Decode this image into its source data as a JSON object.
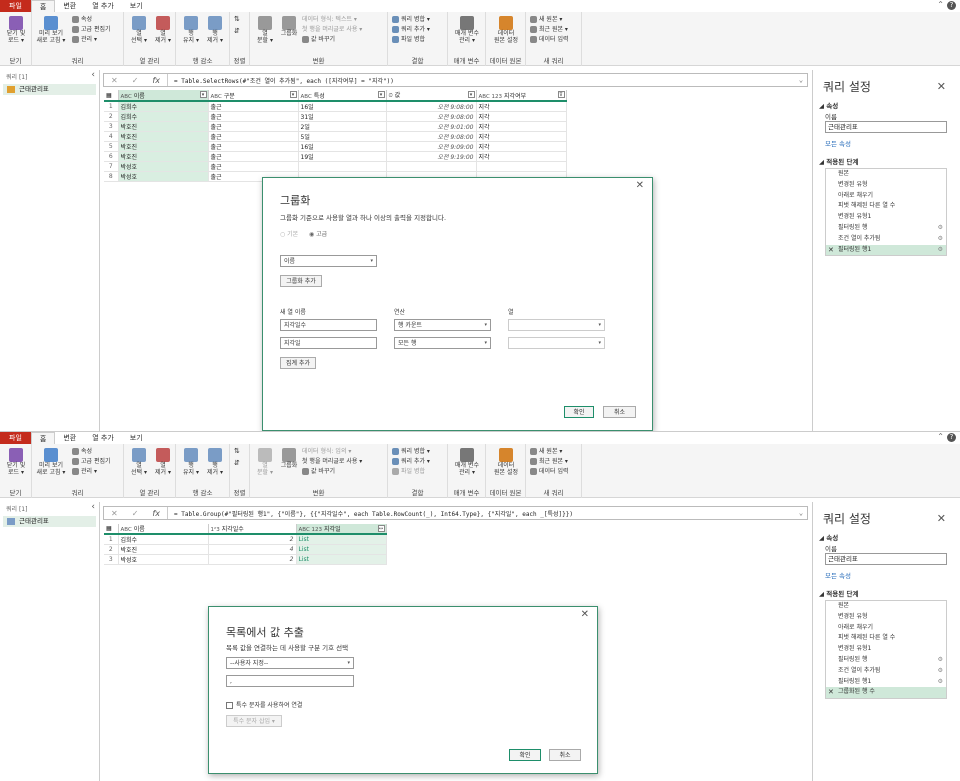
{
  "ribbon": {
    "tabs": [
      "파일",
      "홈",
      "변환",
      "열 추가",
      "보기"
    ],
    "groups": [
      {
        "name": "닫기",
        "buttons": [
          "닫기 및\n로드 ▾"
        ]
      },
      {
        "name": "쿼리",
        "buttons": [
          "미리 보기\n새로 고침 ▾",
          "속성",
          "고급 편집기",
          "관리 ▾"
        ]
      },
      {
        "name": "열 관리",
        "buttons": [
          "열\n선택 ▾",
          "열\n제거 ▾"
        ]
      },
      {
        "name": "행 감소",
        "buttons": [
          "행\n유지 ▾",
          "행\n제거 ▾"
        ]
      },
      {
        "name": "정렬",
        "buttons": []
      },
      {
        "name": "변환",
        "buttons": [
          "열\n분할 ▾",
          "그룹화",
          "첫 행을 머리글로 사용 ▾",
          "값 바꾸기"
        ]
      },
      {
        "name": "결합",
        "buttons": [
          "쿼리 병합 ▾",
          "쿼리 추가 ▾",
          "파일 병합"
        ]
      },
      {
        "name": "매개 변수",
        "buttons": [
          "매개 변수\n관리 ▾"
        ]
      },
      {
        "name": "데이터 원본",
        "buttons": [
          "데이터\n원본 설정"
        ]
      },
      {
        "name": "새 쿼리",
        "buttons": [
          "새 원본 ▾",
          "최근 원본 ▾",
          "데이터 입력"
        ]
      }
    ],
    "datatype_1": "데이터 형식: 텍스트 ▾",
    "datatype_2": "데이터 형식: 임의 ▾"
  },
  "left_panel": {
    "header": "쿼리 [1]",
    "query_name": "근태관리표"
  },
  "screen1": {
    "formula": "= Table.SelectRows(#\"조건 열이 추가됨\", each ([지각여부] = \"지각\"))",
    "columns": [
      {
        "type": "ABC",
        "name": "이름"
      },
      {
        "type": "ABC",
        "name": "구분"
      },
      {
        "type": "ABC",
        "name": "특성"
      },
      {
        "type": "⏲",
        "name": "값"
      },
      {
        "type": "ABC 123",
        "name": "지각여부"
      }
    ],
    "rows": [
      [
        "1",
        "김희수",
        "출근",
        "16일",
        "오전 9:08:00",
        "지각"
      ],
      [
        "2",
        "김희수",
        "출근",
        "31일",
        "오전 9:08:00",
        "지각"
      ],
      [
        "3",
        "박호진",
        "출근",
        "2일",
        "오전 9:01:00",
        "지각"
      ],
      [
        "4",
        "박호진",
        "출근",
        "5일",
        "오전 9:08:00",
        "지각"
      ],
      [
        "5",
        "박호진",
        "출근",
        "16일",
        "오전 9:09:00",
        "지각"
      ],
      [
        "6",
        "박호진",
        "출근",
        "19일",
        "오전 9:19:00",
        "지각"
      ],
      [
        "7",
        "박성호",
        "출근",
        "",
        "",
        ""
      ],
      [
        "8",
        "박성호",
        "출근",
        "",
        "",
        ""
      ]
    ],
    "dialog": {
      "title": "그룹화",
      "subtitle": "그룹화 기준으로 사용할 열과 하나 이상의 출력을 지정합니다.",
      "radio_basic": "○ 기본",
      "radio_advanced": "◉ 고급",
      "group_by_value": "이름",
      "add_group_button": "그룹화 추가",
      "col_new_name": "새 열 이름",
      "col_operation": "연산",
      "col_column": "열",
      "agg1_name": "지각일수",
      "agg1_op": "행 카운트",
      "agg2_name": "지각일",
      "agg2_op": "모든 행",
      "add_agg_button": "집계 추가",
      "ok": "확인",
      "cancel": "취소"
    }
  },
  "screen2": {
    "formula": "= Table.Group(#\"필터링된 행1\", {\"이름\"}, {{\"지각일수\", each Table.RowCount(_), Int64.Type}, {\"지각일\", each _[특성]}})",
    "columns": [
      {
        "type": "ABC",
        "name": "이름"
      },
      {
        "type": "1²3",
        "name": "지각일수"
      },
      {
        "type": "ABC 123",
        "name": "지각일"
      }
    ],
    "rows": [
      [
        "1",
        "김희수",
        "2",
        "List"
      ],
      [
        "2",
        "박호진",
        "4",
        "List"
      ],
      [
        "3",
        "박성호",
        "2",
        "List"
      ]
    ],
    "dialog": {
      "title": "목록에서 값 추출",
      "subtitle": "목록 값을 연결하는 데 사용할 구분 기호 선택",
      "delimiter": "--사용자 지정--",
      "custom_value": ",",
      "special_chars_label": "특수 문자를 사용하여 연결",
      "insert_special": "특수 문자 삽입 ▾",
      "ok": "확인",
      "cancel": "취소"
    }
  },
  "query_settings": {
    "title": "쿼리 설정",
    "properties": "속성",
    "name_label": "이름",
    "name_value": "근태관리표",
    "all_props": "모든 속성",
    "applied_steps": "적용된 단계",
    "steps1": [
      "원본",
      "변경된 유형",
      "아래로 채우기",
      "피벗 해제된 다른 열 수",
      "변경된 유형1",
      "필터링된 행",
      "조건 열이 추가됨",
      "필터링된 행1"
    ],
    "steps2": [
      "원본",
      "변경된 유형",
      "아래로 채우기",
      "피벗 해제된 다른 열 수",
      "변경된 유형1",
      "필터링된 행",
      "조건 열이 추가됨",
      "필터링된 행1",
      "그룹화된 행 수"
    ]
  },
  "colors": {
    "accent": "#1e8e6a",
    "file_tab": "#c42b1c"
  }
}
